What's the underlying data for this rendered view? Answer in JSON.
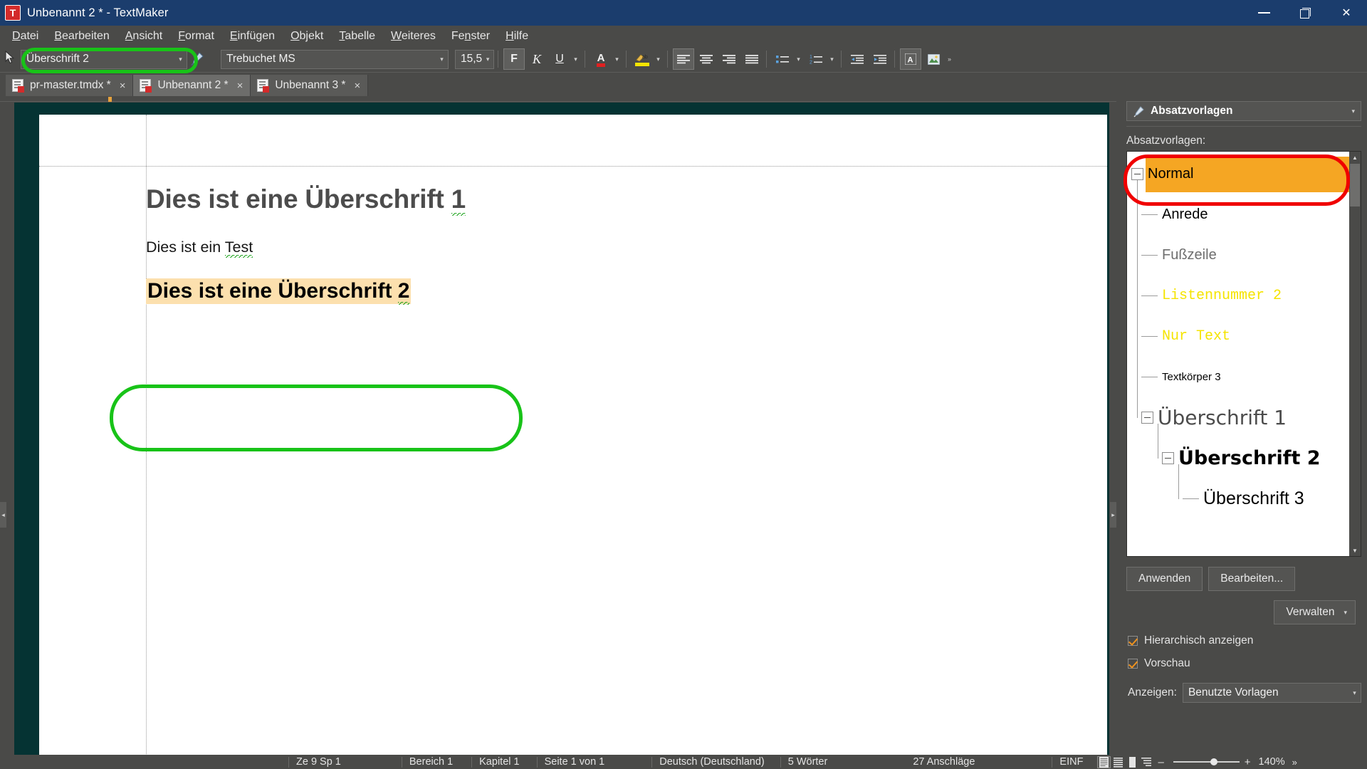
{
  "window": {
    "title": "Unbenannt 2 * - TextMaker",
    "logo_letter": "T",
    "minimize": "minimize-icon",
    "maximize": "restore-icon",
    "close": "✕"
  },
  "menubar": {
    "items": [
      {
        "pre": "",
        "acc": "D",
        "post": "atei"
      },
      {
        "pre": "",
        "acc": "B",
        "post": "earbeiten"
      },
      {
        "pre": "",
        "acc": "A",
        "post": "nsicht"
      },
      {
        "pre": "",
        "acc": "F",
        "post": "ormat"
      },
      {
        "pre": "",
        "acc": "E",
        "post": "infügen"
      },
      {
        "pre": "",
        "acc": "O",
        "post": "bjekt"
      },
      {
        "pre": "",
        "acc": "T",
        "post": "abelle"
      },
      {
        "pre": "",
        "acc": "W",
        "post": "eiteres"
      },
      {
        "pre": "Fe",
        "acc": "n",
        "post": "ster"
      },
      {
        "pre": "",
        "acc": "H",
        "post": "ilfe"
      }
    ]
  },
  "toolbar": {
    "style_value": "Überschrift 2",
    "font_value": "Trebuchet MS",
    "size_value": "15,5",
    "bold_label": "F",
    "italic_label": "K",
    "underline_label": "U",
    "font_color_label": "A",
    "caret": "▾",
    "overflow": "»"
  },
  "tabs": {
    "items": [
      {
        "label": "pr-master.tmdx *",
        "close": "×",
        "active": false
      },
      {
        "label": "Unbenannt 2 *",
        "close": "×",
        "active": true
      },
      {
        "label": "Unbenannt 3 *",
        "close": "×",
        "active": false
      }
    ]
  },
  "document": {
    "heading1": "Dies ist eine Überschrift 1",
    "body": "Dies ist ein Test",
    "heading2": "Dies ist eine Überschrift 2",
    "highlight_color": "#fce0ae"
  },
  "panel": {
    "header_title": "Absatzvorlagen",
    "header_caret": "▾",
    "list_label": "Absatzvorlagen:",
    "styles": [
      {
        "label": "Normal",
        "level": 0,
        "selected": true,
        "expander": true,
        "font": "\"Liberation Sans\", sans-serif",
        "size": "20px",
        "weight": "normal",
        "color": "#000000"
      },
      {
        "label": "Anrede",
        "level": 1,
        "selected": false,
        "expander": false,
        "font": "\"Liberation Sans\", sans-serif",
        "size": "20px",
        "weight": "normal",
        "color": "#000000"
      },
      {
        "label": "Fußzeile",
        "level": 1,
        "selected": false,
        "expander": false,
        "font": "\"Liberation Sans\", sans-serif",
        "size": "20px",
        "weight": "normal",
        "color": "#6e6e6e"
      },
      {
        "label": "Listennummer 2",
        "level": 1,
        "selected": false,
        "expander": false,
        "font": "\"Liberation Mono\", monospace",
        "size": "20px",
        "weight": "normal",
        "color": "#f5e400"
      },
      {
        "label": "Nur Text",
        "level": 1,
        "selected": false,
        "expander": false,
        "font": "\"Liberation Mono\", monospace",
        "size": "20px",
        "weight": "normal",
        "color": "#f5e400"
      },
      {
        "label": "Textkörper 3",
        "level": 1,
        "selected": false,
        "expander": false,
        "font": "\"Liberation Sans\", sans-serif",
        "size": "15px",
        "weight": "normal",
        "color": "#000000"
      },
      {
        "label": "Überschrift 1",
        "level": 1,
        "selected": false,
        "expander": true,
        "font": "\"DejaVu Sans\", sans-serif",
        "size": "28px",
        "weight": "normal",
        "color": "#4c4c4c"
      },
      {
        "label": "Überschrift 2",
        "level": 2,
        "selected": false,
        "expander": true,
        "font": "\"DejaVu Sans\", sans-serif",
        "size": "27px",
        "weight": "bold",
        "color": "#000000"
      },
      {
        "label": "Überschrift 3",
        "level": 3,
        "selected": false,
        "expander": false,
        "font": "\"Liberation Sans\", sans-serif",
        "size": "25px",
        "weight": "normal",
        "color": "#000000"
      }
    ],
    "apply_button": "Anwenden",
    "edit_button": "Bearbeiten...",
    "manage_button": "Verwalten",
    "manage_caret": "▾",
    "checkbox_hierarchical": "Hierarchisch anzeigen",
    "checkbox_preview": "Vorschau",
    "show_label": "Anzeigen:",
    "show_value": "Benutzte Vorlagen",
    "show_caret": "▾",
    "scroll_up": "▲",
    "scroll_down": "▼",
    "selected_color": "#f5a623"
  },
  "statusbar": {
    "line_col": "Ze 9 Sp 1",
    "section": "Bereich 1",
    "chapter": "Kapitel 1",
    "page": "Seite 1 von 1",
    "language": "Deutsch (Deutschland)",
    "words": "5 Wörter",
    "chars": "27 Anschläge",
    "insert_mode": "EINF",
    "zoom": "140%",
    "zoom_minus": "–",
    "zoom_plus": "+",
    "overflow": "»"
  },
  "colors": {
    "titlebar": "#1b3d6d",
    "chrome": "#4a4a48",
    "canvas": "#053333",
    "annotation_green": "#18c318",
    "annotation_red": "#f00000"
  }
}
